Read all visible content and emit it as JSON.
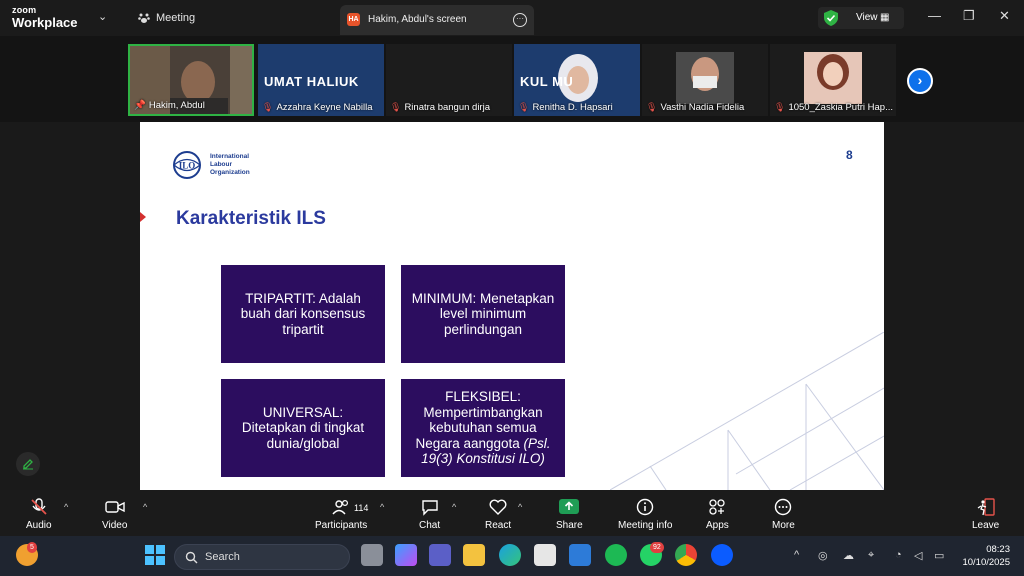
{
  "titlebar": {
    "brand_top": "zoom",
    "brand_bottom": "Workplace",
    "meeting_label": "Meeting",
    "tab_initials": "HA",
    "tab_title": "Hakim, Abdul's screen",
    "view_label": "View",
    "colors": {
      "shield": "#2fb344",
      "tab_badge": "#e8542b"
    }
  },
  "participants_strip": [
    {
      "name": "Hakim, Abdul",
      "muted": false,
      "active": true
    },
    {
      "name": "Azzahra Keyne Nabilla",
      "muted": true,
      "banner": "UMAT HALIUK"
    },
    {
      "name": "Rinatra bangun dirja",
      "muted": true
    },
    {
      "name": "Renitha D. Hapsari",
      "muted": true,
      "banner": "KUL   MU"
    },
    {
      "name": "Vasthi Nadia Fidelia",
      "muted": true
    },
    {
      "name": "1050_Zaskia Putri Hap...",
      "muted": true
    }
  ],
  "slide": {
    "org_line1": "International",
    "org_line2": "Labour",
    "org_line3": "Organization",
    "logo_text": "ILO",
    "page_number": "8",
    "title": "Karakteristik ILS",
    "cards": [
      {
        "text": "TRIPARTIT: Adalah buah dari konsensus tripartit"
      },
      {
        "text": "MINIMUM: Menetapkan level minimum perlindungan"
      },
      {
        "text": "UNIVERSAL: Ditetapkan di tingkat dunia/global"
      },
      {
        "text_main": "FLEKSIBEL: Mempertimbangkan kebutuhan semua Negara aanggota ",
        "text_italic": "(Psl. 19(3) Konstitusi ILO)"
      }
    ],
    "colors": {
      "title": "#2b3a9e",
      "card_bg": "#2c0d5f"
    }
  },
  "toolbar": {
    "audio": "Audio",
    "video": "Video",
    "participants": "Participants",
    "participants_count": "114",
    "chat": "Chat",
    "react": "React",
    "share": "Share",
    "meeting_info": "Meeting info",
    "apps": "Apps",
    "more": "More",
    "leave": "Leave",
    "colors": {
      "share": "#1f9d55",
      "leave": "#e5534b"
    }
  },
  "taskbar": {
    "search_placeholder": "Search",
    "time": "08:23",
    "date": "10/10/2025",
    "weather_badge": "5",
    "whatsapp_badge": "92"
  }
}
